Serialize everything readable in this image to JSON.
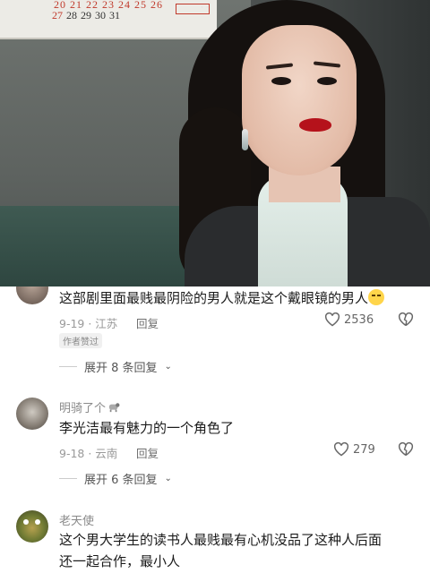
{
  "video": {
    "calendar_row1": [
      "20",
      "21",
      "22",
      "23",
      "24",
      "25",
      "26"
    ],
    "calendar_row2": [
      "27",
      "28",
      "29",
      "30",
      "31"
    ],
    "watermark": "· ·"
  },
  "comments": [
    {
      "username": "",
      "text": "这部剧里面最贱最阴险的男人就是这个戴眼镜的男人",
      "emoji": "crying-emoji",
      "date_location": "9-19 · 江苏",
      "reply_label": "回复",
      "likes": "2536",
      "tag": "作者赞过",
      "expand_label": "展开 8 条回复"
    },
    {
      "username": "明骑了个",
      "text": "李光洁最有魅力的一个角色了",
      "date_location": "9-18 · 云南",
      "reply_label": "回复",
      "likes": "279",
      "expand_label": "展开 6 条回复"
    },
    {
      "username": "老天使",
      "text_line1": "这个男大学生的读书人最贱最有心机没品了这种人后面",
      "text_line2": "还一起合作，最小人"
    }
  ],
  "colors": {
    "accent_red": "#c0392b",
    "lipstick": "#b5121b",
    "meta_gray": "#9a9a9a"
  }
}
